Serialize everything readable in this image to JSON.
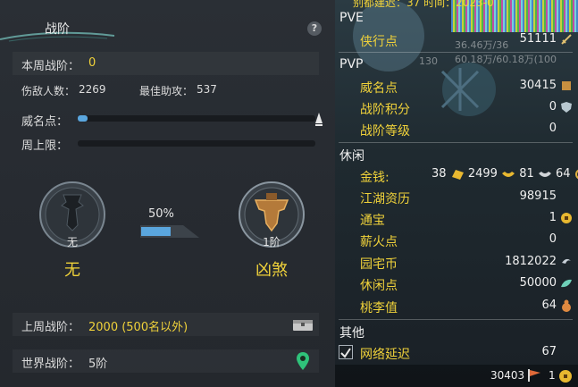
{
  "left": {
    "title": "战阶",
    "help_symbol": "?",
    "this_week": {
      "label": "本周战阶：",
      "value": "0"
    },
    "injured": {
      "label": "伤敌人数：",
      "value": "2269"
    },
    "best_assist": {
      "label": "最佳助攻：",
      "value": "537"
    },
    "prestige": {
      "label": "威名点：",
      "progress": 0.04
    },
    "weekly_cap": {
      "label": "周上限：",
      "progress": 0.0
    },
    "current_rank": {
      "level": "无",
      "name": "无"
    },
    "next_rank": {
      "level": "1阶",
      "name": "凶煞"
    },
    "upgrade_progress": {
      "text": "50%",
      "value": 0.5
    },
    "last_week": {
      "label": "上周战阶：",
      "value": "2000 (500名以外)"
    },
    "world": {
      "label": "世界战阶：",
      "value": "5阶"
    },
    "colors": {
      "accent_yellow": "#f0d23a",
      "bar_blue": "#5aa6de"
    }
  },
  "right": {
    "top_clip_text": "别都建迟：37  时间：2023-0",
    "ghost_1": "36.46万/36",
    "ghost_2": "60.18万/60.18万(100",
    "ghost_3": "130",
    "pve": {
      "heading": "PVE",
      "rows": [
        {
          "label": "侠行点",
          "value": "51111",
          "icon": "sword-icon"
        }
      ]
    },
    "pvp": {
      "heading": "PVP",
      "rows": [
        {
          "label": "威名点",
          "value": "30415",
          "icon": "prestige-icon"
        },
        {
          "label": "战阶积分",
          "value": "0",
          "icon": "shield-icon"
        },
        {
          "label": "战阶等级",
          "value": "0",
          "icon": ""
        }
      ]
    },
    "leisure": {
      "heading": "休闲",
      "money_label": "金钱:",
      "money": {
        "gold_brick": "38",
        "gold": "2499",
        "silver": "81",
        "copper": "64"
      },
      "rows": [
        {
          "label": "江湖资历",
          "value": "98915",
          "icon": ""
        },
        {
          "label": "通宝",
          "value": "1",
          "icon": "coin-icon"
        },
        {
          "label": "薪火点",
          "value": "0",
          "icon": ""
        },
        {
          "label": "园宅币",
          "value": "1812022",
          "icon": "house-coin-icon"
        },
        {
          "label": "休闲点",
          "value": "50000",
          "icon": "leaf-icon"
        },
        {
          "label": "桃李值",
          "value": "64",
          "icon": "gourd-icon"
        }
      ]
    },
    "other": {
      "heading": "其他",
      "latency": {
        "label": "网络延迟",
        "value": "67",
        "checked": true
      }
    },
    "bottom": {
      "value1": "30403",
      "value2": "1"
    }
  }
}
